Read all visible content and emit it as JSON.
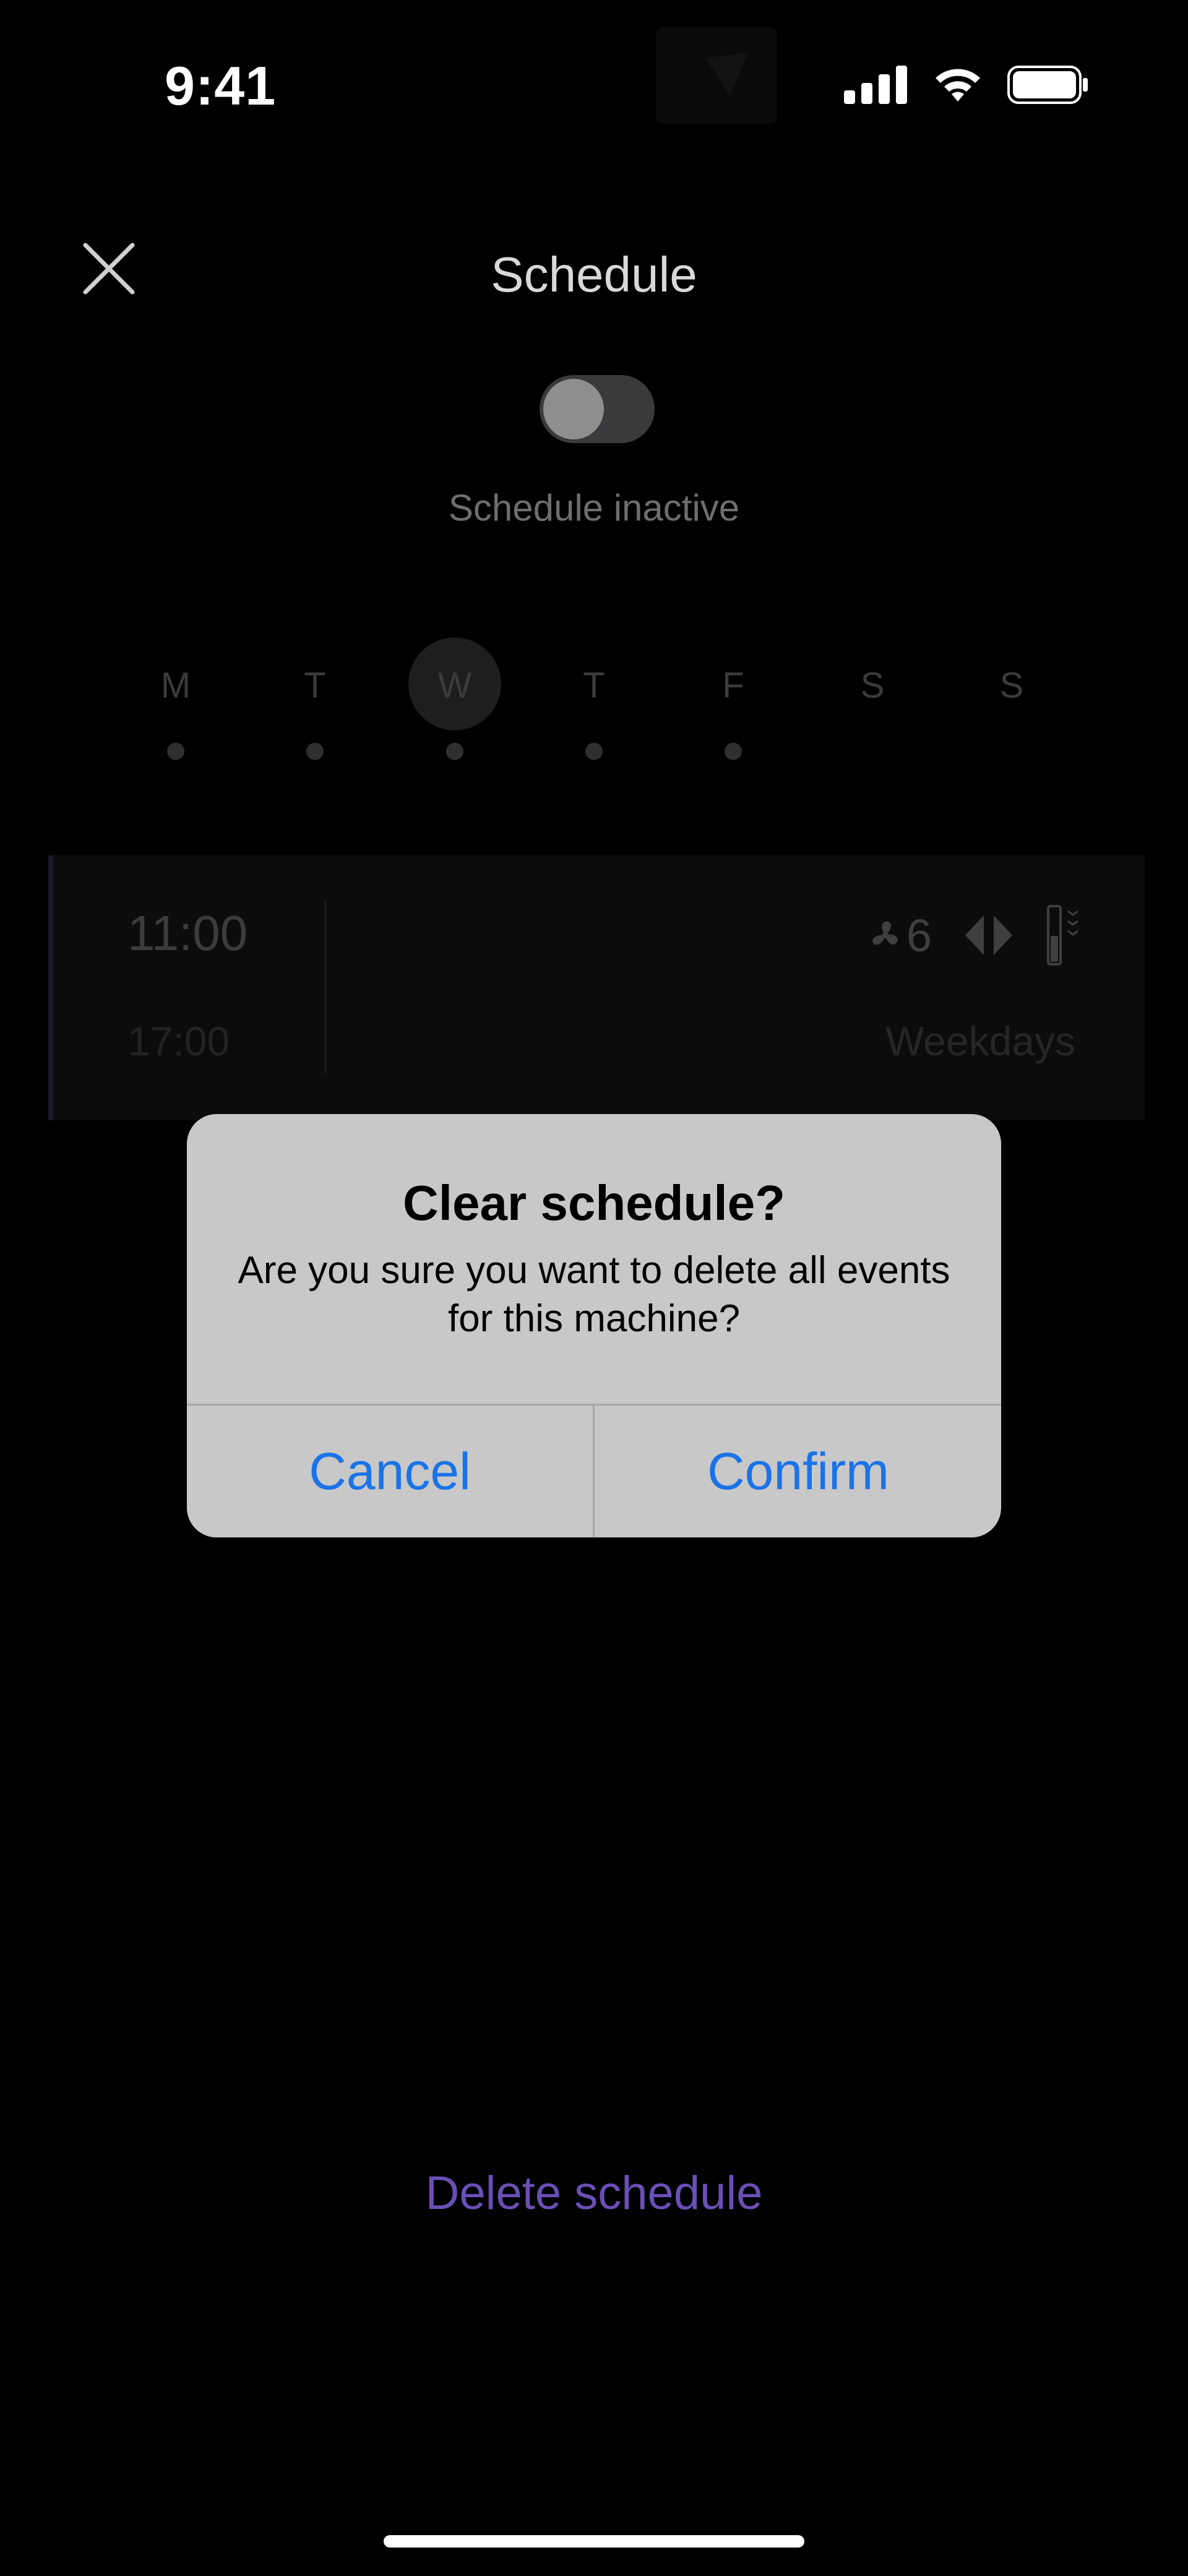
{
  "status_bar": {
    "time": "9:41"
  },
  "header": {
    "title": "Schedule",
    "toggle_state": "off",
    "status_text": "Schedule inactive"
  },
  "days": [
    {
      "label": "M",
      "has_event": true,
      "selected": false
    },
    {
      "label": "T",
      "has_event": true,
      "selected": false
    },
    {
      "label": "W",
      "has_event": true,
      "selected": true
    },
    {
      "label": "T",
      "has_event": true,
      "selected": false
    },
    {
      "label": "F",
      "has_event": true,
      "selected": false
    },
    {
      "label": "S",
      "has_event": false,
      "selected": false
    },
    {
      "label": "S",
      "has_event": false,
      "selected": false
    }
  ],
  "event": {
    "start": "11:00",
    "end": "17:00",
    "fan_speed": "6",
    "recurrence": "Weekdays"
  },
  "alert": {
    "title": "Clear schedule?",
    "message": "Are you sure you want to delete all events for this machine?",
    "cancel_label": "Cancel",
    "confirm_label": "Confirm"
  },
  "footer": {
    "delete_label": "Delete schedule"
  },
  "colors": {
    "accent_blue": "#1a73e8",
    "delete_purple": "#6a4fb6",
    "alert_bg": "#c8c8c8"
  }
}
